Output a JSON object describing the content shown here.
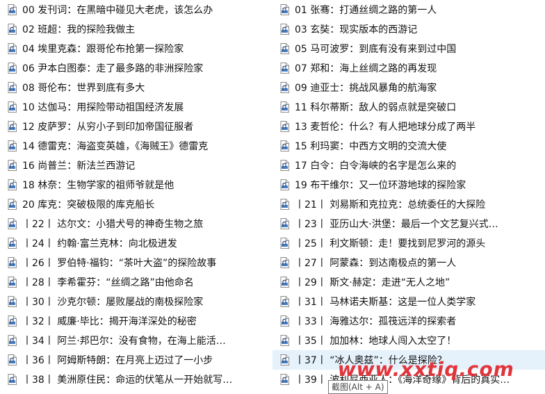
{
  "files": {
    "icon": "audio-file-icon",
    "items": [
      {
        "name": "00 发刊词：在黑暗中碰见大老虎，该怎么办"
      },
      {
        "name": "01 张骞：打通丝绸之路的第一人"
      },
      {
        "name": "02 班超：我的探险我做主"
      },
      {
        "name": "03 玄奘：现实版本的西游记"
      },
      {
        "name": "04 埃里克森：跟哥伦布抢第一探险家"
      },
      {
        "name": "05 马可波罗：到底有没有来到过中国"
      },
      {
        "name": "06 尹本白图泰：走了最多路的非洲探险家"
      },
      {
        "name": "07 郑和：海上丝绸之路的再发现"
      },
      {
        "name": "08 哥伦布：世界到底有多大"
      },
      {
        "name": "09 迪亚士：挑战风暴角的航海家"
      },
      {
        "name": "10 达伽马：用探险带动祖国经济发展"
      },
      {
        "name": "11 科尔蒂斯：敌人的弱点就是突破口"
      },
      {
        "name": "12 皮萨罗：从穷小子到印加帝国征服者"
      },
      {
        "name": "13 麦哲伦：什么？有人把地球分成了两半"
      },
      {
        "name": "14 德雷克：海盗变英雄，《海贼王》德雷克"
      },
      {
        "name": "15 利玛窦：中西方文明的交流大使"
      },
      {
        "name": "16 尚普兰：新法兰西游记"
      },
      {
        "name": "17 白令：白令海峡的名字是怎么来的"
      },
      {
        "name": "18 林奈：生物学家的祖师爷就是他"
      },
      {
        "name": "19 布干维尔：又一位环游地球的探险家"
      },
      {
        "name": "20 库克：突破极限的库克船长"
      },
      {
        "name": "丨21丨 刘易斯和克拉克：总统委任的大探险"
      },
      {
        "name": "丨22丨 达尔文：小猎犬号的神奇生物之旅"
      },
      {
        "name": "丨23丨 亚历山大·洪堡：最后一个文艺复兴式…"
      },
      {
        "name": "丨24丨 约翰·富兰克林：向北极进发"
      },
      {
        "name": "丨25丨 利文斯顿：走！要找到尼罗河的源头"
      },
      {
        "name": "丨26丨 罗伯特·福钧：“茶叶大盗”的探险故事"
      },
      {
        "name": "丨27丨 阿蒙森：到达南极点的第一人"
      },
      {
        "name": "丨28丨 李希霍芬：“丝绸之路”由他命名"
      },
      {
        "name": "丨29丨 斯文·赫定：走进“无人之地”"
      },
      {
        "name": "丨30丨 沙克尔顿：屡败屡战的南极探险家"
      },
      {
        "name": "丨31丨 马林诺夫斯基：这是一位人类学家"
      },
      {
        "name": "丨32丨 威廉·毕比：揭开海洋深处的秘密"
      },
      {
        "name": "丨33丨 海雅达尔：孤筏远洋的探索者"
      },
      {
        "name": "丨34丨 阿兰·邦巴尔：没有食物，在海上能活…"
      },
      {
        "name": "丨35丨 加加林：地球人闯入太空了！"
      },
      {
        "name": "丨36丨 阿姆斯特朗：在月亮上迈过了一小步"
      },
      {
        "name": "丨37丨 “冰人奥兹”：什么是探险？"
      },
      {
        "name": "丨38丨 美洲原住民：命运的伏笔从一开始就写…"
      },
      {
        "name": "丨39丨 波利尼西亚人：《海洋奇缘》背后的真实…"
      }
    ],
    "selected_index": 37
  },
  "tooltip": {
    "text": "截图(Alt + A)"
  },
  "watermark": {
    "text": "www.xxtiq.com",
    "color": "#e1353c"
  },
  "colors": {
    "selection": "#e5f1fb",
    "background": "#ffffff",
    "text": "#111111"
  }
}
